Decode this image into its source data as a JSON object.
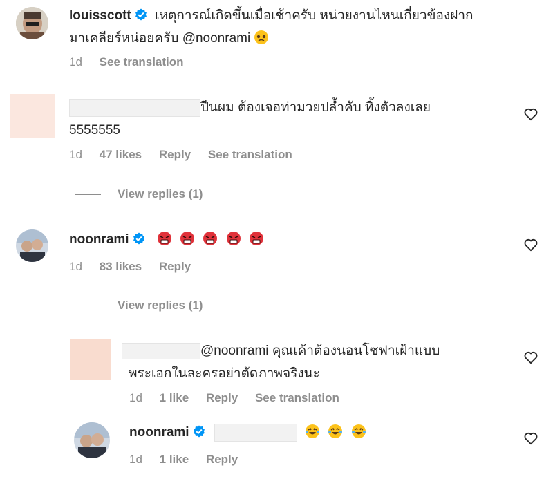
{
  "comments": [
    {
      "username": "louisscott",
      "text_line1": "เหตุการณ์เกิดขึ้นเมื่อเช้าครับ หน่วยงานไหนเกี่ยวข้องฝาก",
      "text_line2": "มาเคลียร์หน่อยครับ @noonrami",
      "time": "1d",
      "see_translation": "See translation"
    },
    {
      "text_line1": "ปีนผม ต้องเจอท่ามวยปล้ำคับ ทิ้งตัวลงเลย",
      "text_line2": "5555555",
      "time": "1d",
      "likes": "47 likes",
      "reply": "Reply",
      "see_translation": "See translation",
      "view_replies": "View replies (1)"
    },
    {
      "username": "noonrami",
      "time": "1d",
      "likes": "83 likes",
      "reply": "Reply",
      "view_replies": "View replies (1)"
    },
    {
      "text_line1": "@noonrami คุณเค้าต้องนอนโซฟาเฝ้าแบบ",
      "text_line2": "พระเอกในละครอย่าตัดภาพจริงนะ",
      "time": "1d",
      "likes": "1 like",
      "reply": "Reply",
      "see_translation": "See translation"
    },
    {
      "username": "noonrami",
      "time": "1d",
      "likes": "1 like",
      "reply": "Reply"
    }
  ],
  "icons": {
    "heart": "heart-outline-icon",
    "verified": "verified-badge-icon",
    "emoji_angry": "angry-face-emoji",
    "emoji_laugh": "laughing-tears-emoji",
    "emoji_sad": "pleading-face-emoji"
  },
  "colors": {
    "text": "#262626",
    "meta": "#8e8e8e",
    "verified": "#0095f6"
  }
}
